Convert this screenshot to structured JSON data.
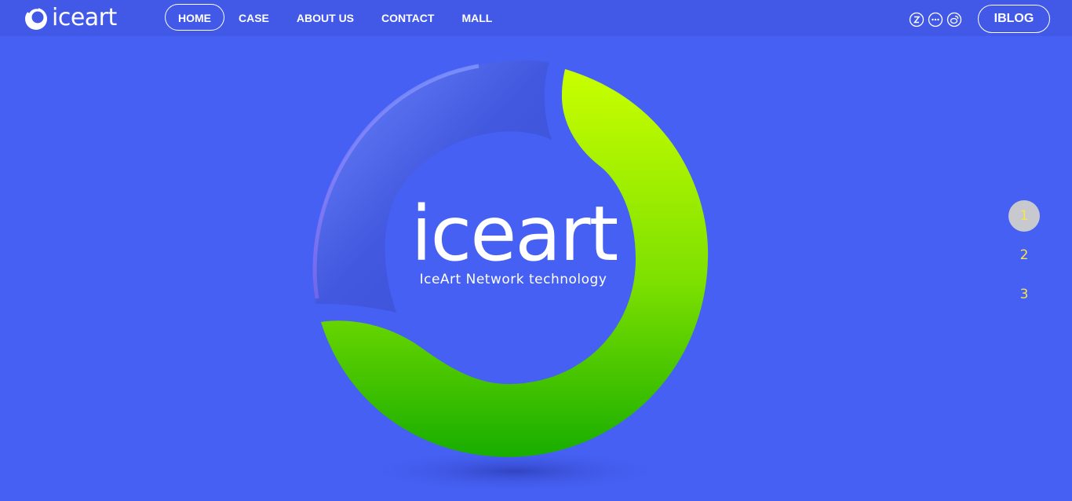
{
  "brand": {
    "logo_text": "iceart"
  },
  "nav": {
    "items": [
      {
        "label": "HOME",
        "active": true
      },
      {
        "label": "CASE"
      },
      {
        "label": "ABOUT US"
      },
      {
        "label": "CONTACT"
      },
      {
        "label": "MALL"
      }
    ]
  },
  "social": {
    "icons": [
      "zhihu-icon",
      "wechat-icon",
      "weibo-icon"
    ]
  },
  "blog_button": {
    "label": "IBLOG"
  },
  "hero": {
    "wordmark": "iceart",
    "tagline": "IceArt Network technology"
  },
  "pager": {
    "items": [
      "1",
      "2",
      "3"
    ],
    "active_index": 0
  },
  "colors": {
    "background": "#4660f4",
    "topbar": "#4259e8",
    "ring_green_light": "#c6ff00",
    "ring_green_dark": "#19b000",
    "pager_number": "#f7e34a"
  }
}
